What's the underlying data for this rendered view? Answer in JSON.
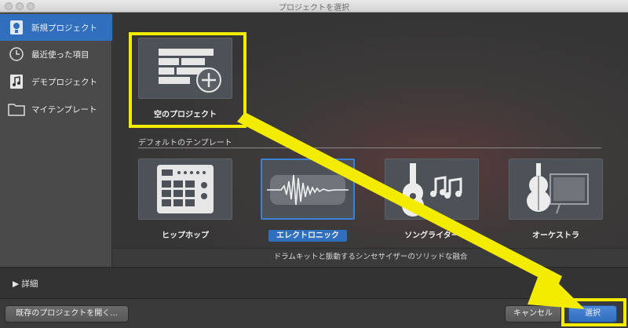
{
  "window": {
    "title": "プロジェクトを選択"
  },
  "sidebar": {
    "items": [
      {
        "label": "新規プロジェクト",
        "icon": "new-project-icon",
        "selected": true
      },
      {
        "label": "最近使った項目",
        "icon": "clock-icon",
        "selected": false
      },
      {
        "label": "デモプロジェクト",
        "icon": "music-note-icon",
        "selected": false
      },
      {
        "label": "マイテンプレート",
        "icon": "folder-icon",
        "selected": false
      }
    ]
  },
  "main": {
    "empty_project": {
      "label": "空のプロジェクト",
      "icon": "empty-project-plus-icon"
    },
    "section_header": "デフォルトのテンプレート",
    "templates": [
      {
        "label": "ヒップホップ",
        "icon": "drum-pad-icon",
        "selected": false
      },
      {
        "label": "エレクトロニック",
        "icon": "waveform-icon",
        "selected": true
      },
      {
        "label": "ソングライター",
        "icon": "guitar-notes-icon",
        "selected": false
      },
      {
        "label": "オーケストラ",
        "icon": "violin-icon",
        "selected": false
      }
    ],
    "description": "ドラムキットと脈動するシンセサイザーのソリッドな融合"
  },
  "details": {
    "label": "▶ 詳細"
  },
  "buttons": {
    "open_existing": "既存のプロジェクトを開く...",
    "cancel": "キャンセル",
    "choose": "選択"
  },
  "colors": {
    "highlight": "#f4ec00",
    "selection": "#2f6fbd",
    "accent_border": "#3b82d6"
  }
}
